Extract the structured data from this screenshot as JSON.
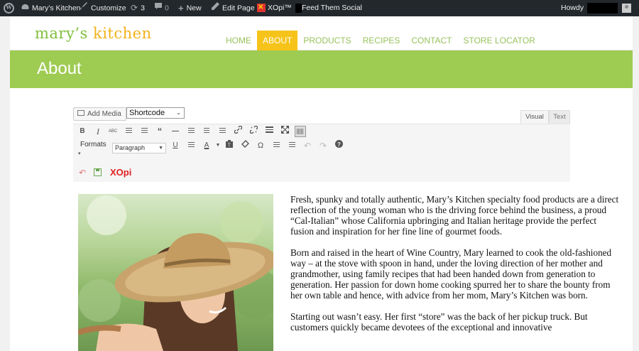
{
  "admin_bar": {
    "site_name": "Mary's Kitchen",
    "customize": "Customize",
    "updates_count": "3",
    "comments_count": "0",
    "new_label": "New",
    "edit_page": "Edit Page",
    "xopi_label": "XOpi™",
    "feed_label": "Feed Them Social",
    "howdy": "Howdy"
  },
  "site": {
    "logo_first": "mary’s",
    "logo_second": " kitchen",
    "nav": [
      "HOME",
      "ABOUT",
      "PRODUCTS",
      "RECIPES",
      "CONTACT",
      "STORE LOCATOR"
    ],
    "active_nav": "ABOUT",
    "banner_title": "About",
    "colors": {
      "accent_green": "#9ecb52",
      "accent_yellow": "#f6c31a",
      "admin_bar": "#23282d"
    }
  },
  "editor": {
    "add_media": "Add Media",
    "shortcode": "Shortcode",
    "tab_visual": "Visual",
    "tab_text": "Text",
    "formats": "Formats",
    "paragraph": "Paragraph",
    "xopi_brand": "XOpi"
  },
  "content": {
    "paragraphs": [
      "Fresh, spunky and totally authentic, Mary’s Kitchen specialty food products are a direct reflection of the young woman who is the driving force behind the business, a proud “Cal-Italian” whose California upbringing and Italian heritage provide the perfect fusion and inspiration for her fine line of gourmet foods.",
      "Born and raised in the heart of Wine Country, Mary learned to cook the old-fashioned way – at the stove with spoon in hand, under the loving direction of her mother and grandmother, using family recipes that had been handed down from generation to generation. Her passion for down home cooking spurred her to share the bounty from her own table and hence, with advice from her mom, Mary’s Kitchen was born.",
      "Starting out wasn’t easy. Her first “store” was the back of her pickup truck. But customers quickly became devotees of the exceptional and innovative"
    ]
  }
}
